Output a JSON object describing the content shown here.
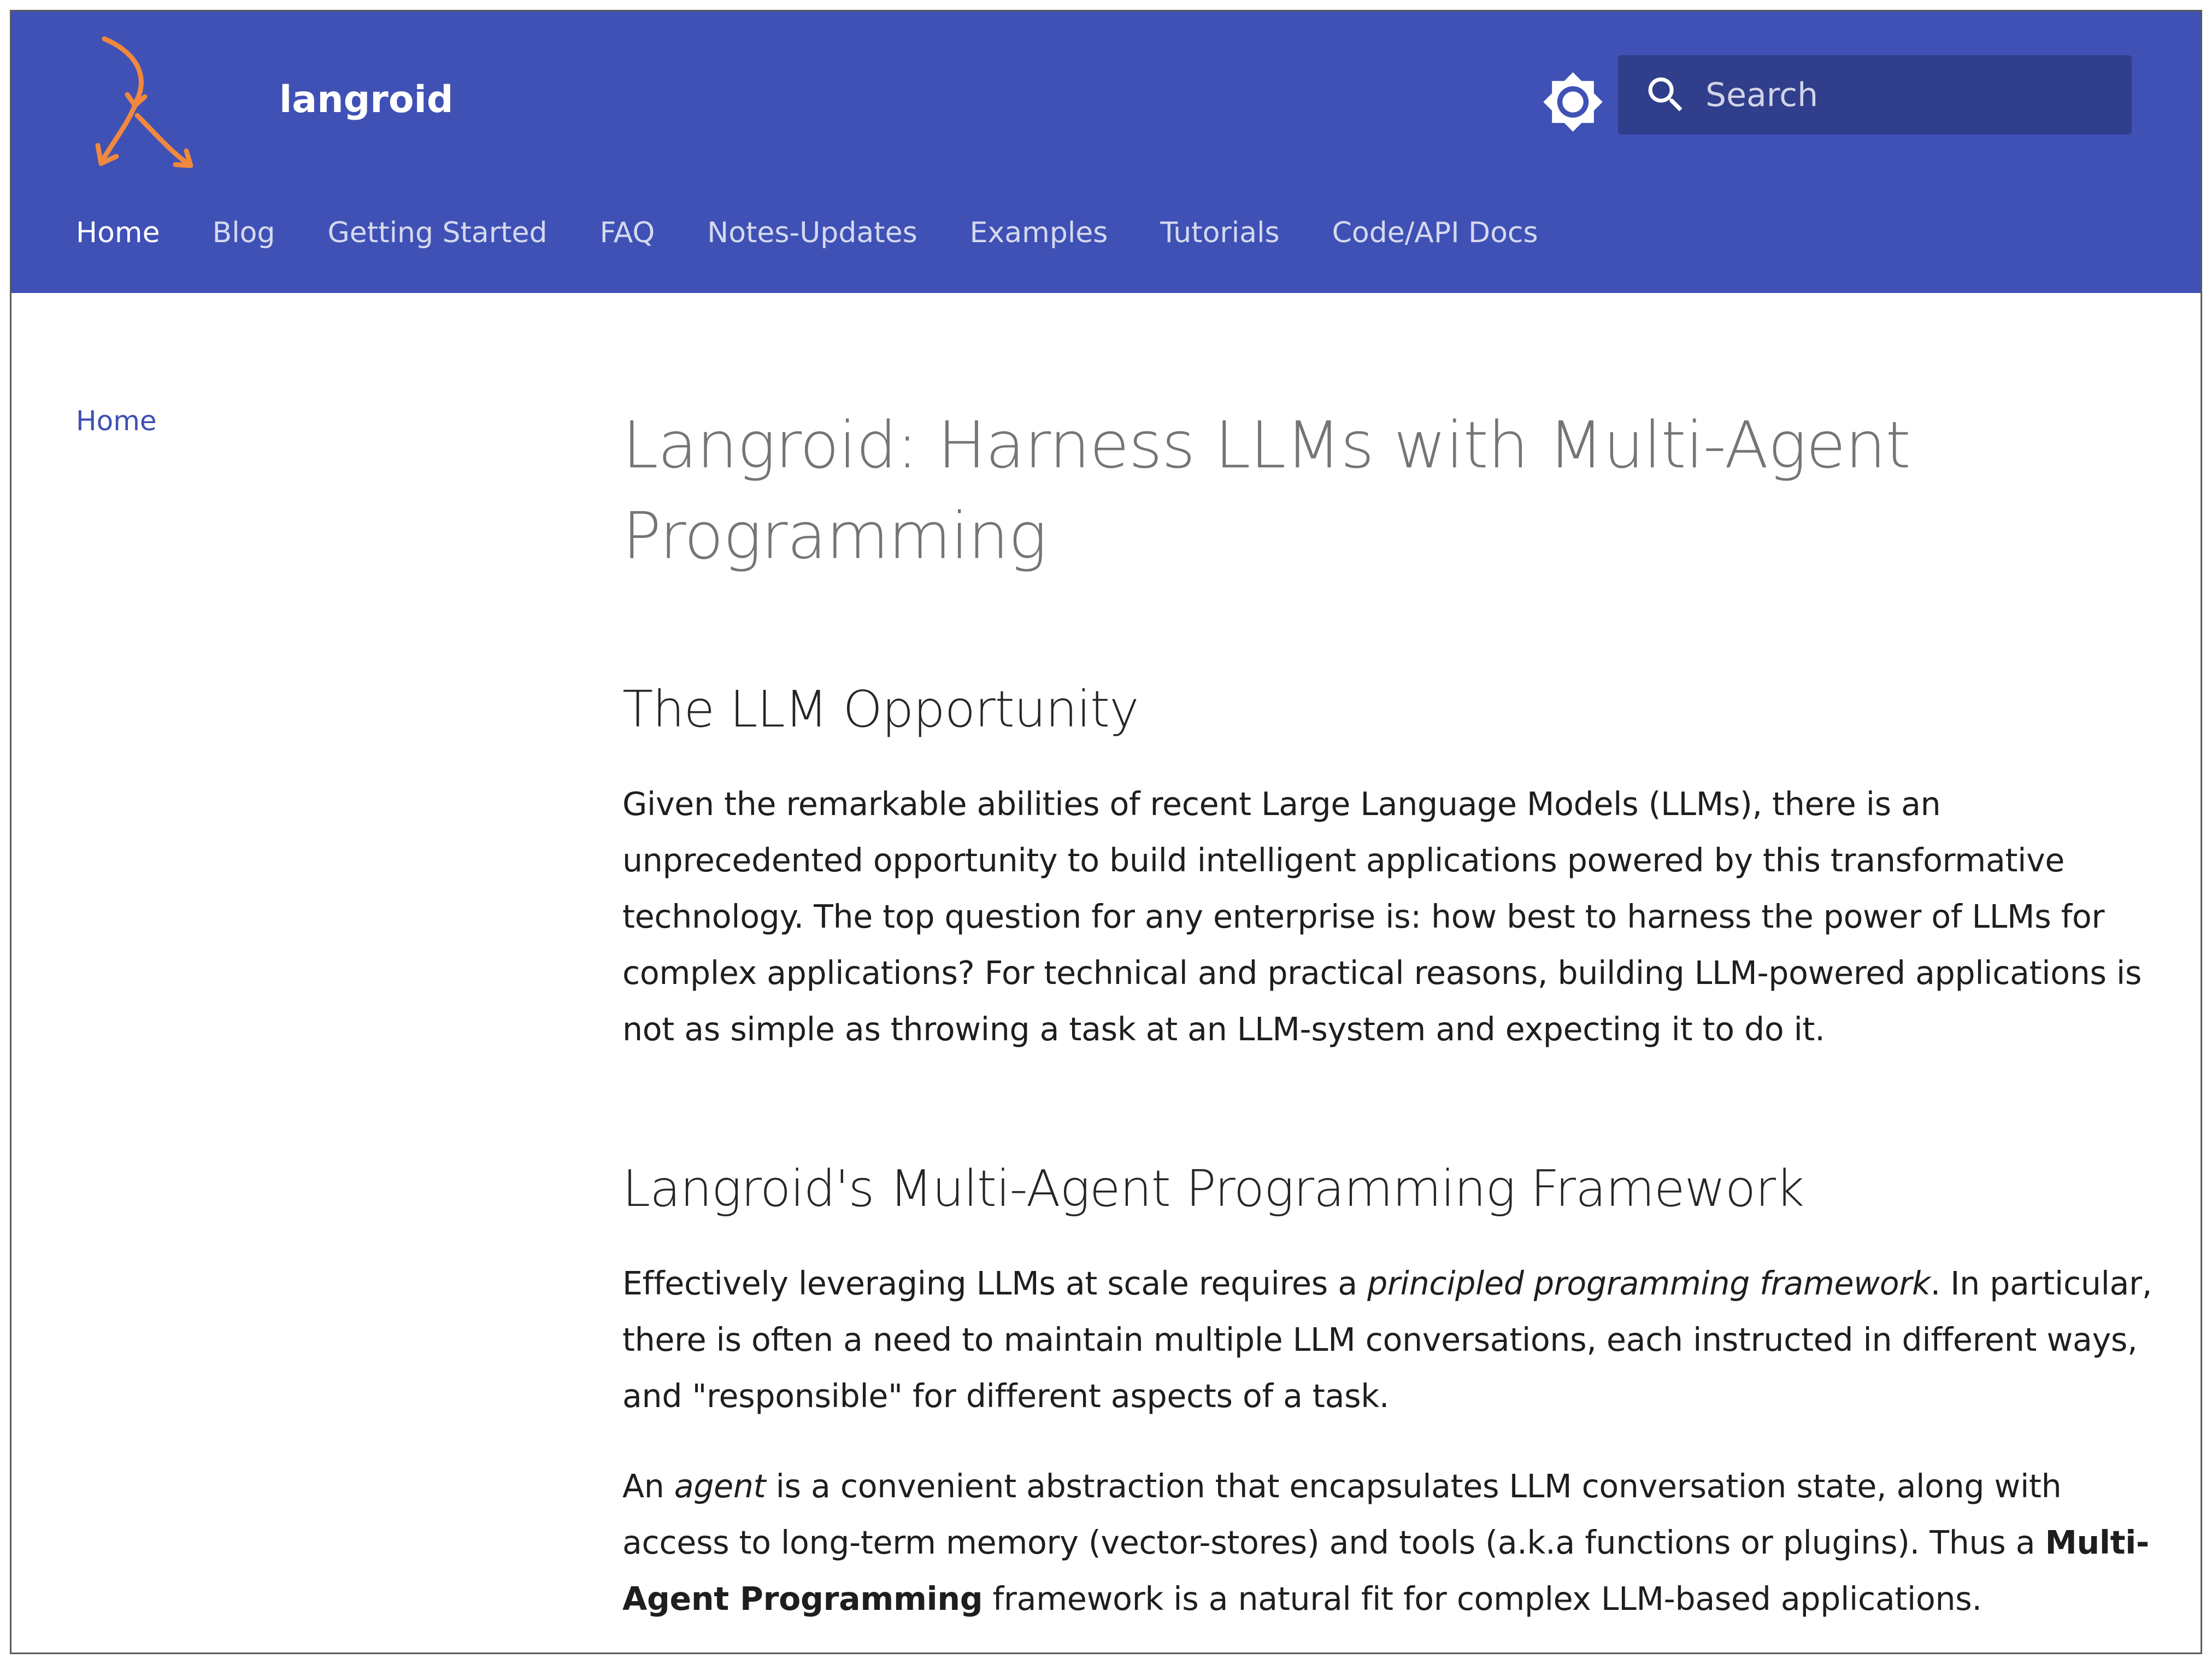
{
  "colors": {
    "primary": "#3f51b5",
    "search_bg": "#303e8c",
    "logo_orange": "#f0883e"
  },
  "header": {
    "logo_icon": "langroid-arrows-logo",
    "site_title": "langroid",
    "theme_toggle_icon": "brightness-icon",
    "search": {
      "icon": "search-icon",
      "placeholder": "Search"
    }
  },
  "tabs": [
    {
      "label": "Home",
      "active": true
    },
    {
      "label": "Blog"
    },
    {
      "label": "Getting Started"
    },
    {
      "label": "FAQ"
    },
    {
      "label": "Notes-Updates"
    },
    {
      "label": "Examples"
    },
    {
      "label": "Tutorials"
    },
    {
      "label": "Code/API Docs"
    }
  ],
  "sidebar": {
    "items": [
      {
        "label": "Home"
      }
    ]
  },
  "content": {
    "title": "Langroid: Harness LLMs with Multi-Agent Programming",
    "sections": [
      {
        "heading": "The LLM Opportunity",
        "paragraphs": [
          {
            "text": "Given the remarkable abilities of recent Large Language Models (LLMs), there is an unprecedented opportunity to build intelligent applications powered by this transformative technology. The top question for any enterprise is: how best to harness the power of LLMs for complex applications? For technical and practical reasons, building LLM-powered applications is not as simple as throwing a task at an LLM-system and expecting it to do it."
          }
        ]
      },
      {
        "heading": "Langroid's Multi-Agent Programming Framework",
        "paragraphs": [
          {
            "before": "Effectively leveraging LLMs at scale requires a ",
            "em": "principled programming framework",
            "after": ". In particular, there is often a need to maintain multiple LLM conversations, each instructed in different ways, and \"responsible\" for different aspects of a task."
          },
          {
            "before": "An ",
            "em": "agent",
            "middle": " is a convenient abstraction that encapsulates LLM conversation state, along with access to long-term memory (vector-stores) and tools (a.k.a functions or plugins). Thus a ",
            "strong": "Multi-Agent Programming",
            "after": " framework is a natural fit for complex LLM-based applications."
          }
        ]
      }
    ]
  }
}
